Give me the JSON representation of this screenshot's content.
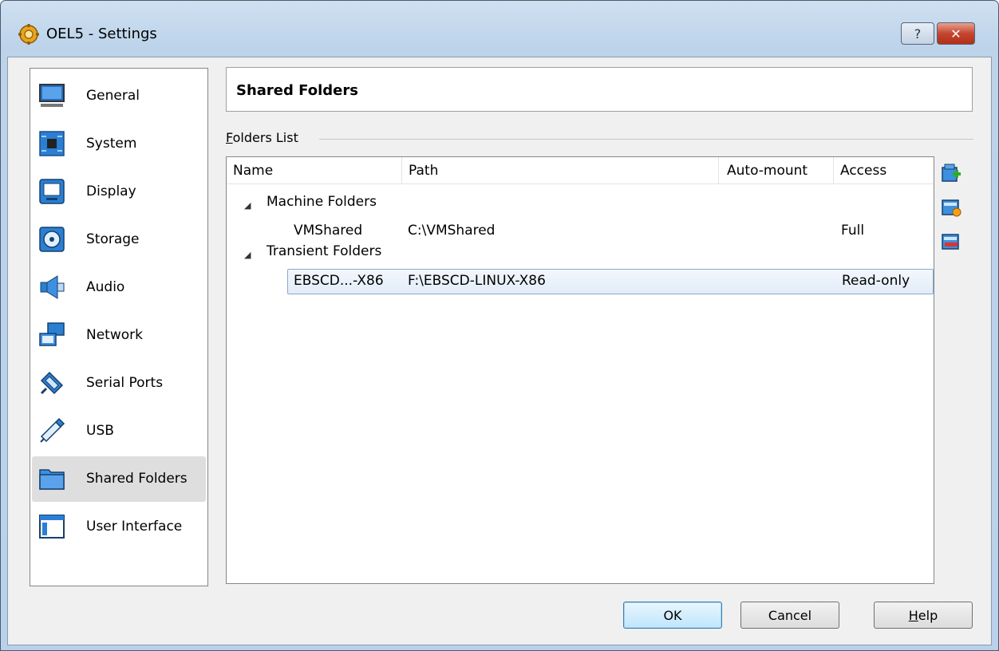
{
  "window": {
    "title": "OEL5 - Settings",
    "help_glyph": "?",
    "close_glyph": "✕"
  },
  "sidebar": {
    "items": [
      {
        "label": "General",
        "icon": "monitor-icon"
      },
      {
        "label": "System",
        "icon": "chip-icon"
      },
      {
        "label": "Display",
        "icon": "display-icon"
      },
      {
        "label": "Storage",
        "icon": "storage-icon"
      },
      {
        "label": "Audio",
        "icon": "speaker-icon"
      },
      {
        "label": "Network",
        "icon": "network-icon"
      },
      {
        "label": "Serial Ports",
        "icon": "serial-port-icon"
      },
      {
        "label": "USB",
        "icon": "usb-icon"
      },
      {
        "label": "Shared Folders",
        "icon": "folder-icon",
        "selected": true
      },
      {
        "label": "User Interface",
        "icon": "window-icon"
      }
    ]
  },
  "main": {
    "title": "Shared Folders",
    "group_label_mnemonic": "F",
    "group_label_rest": "olders List",
    "columns": [
      "Name",
      "Path",
      "Auto-mount",
      "Access"
    ],
    "groups": [
      {
        "expander": "◢",
        "name": "Machine Folders",
        "rows": [
          {
            "name": "VMShared",
            "path": "C:\\VMShared",
            "auto_mount": "",
            "access": "Full"
          }
        ]
      },
      {
        "expander": "◢",
        "name": "Transient Folders",
        "rows": [
          {
            "name": "EBSCD...-X86",
            "path": "F:\\EBSCD-LINUX-X86",
            "auto_mount": "",
            "access": "Read-only",
            "selected": true
          }
        ]
      }
    ]
  },
  "side_actions": [
    "add-folder-icon",
    "edit-folder-icon",
    "remove-folder-icon"
  ],
  "buttons": {
    "ok": "OK",
    "cancel": "Cancel",
    "help_mnemonic": "H",
    "help_rest": "elp"
  },
  "colors": {
    "title_gradient": "#cfe0f1",
    "selection": "#e2ecf8",
    "selection_border": "#8ba8cc",
    "nav_selected": "#dedede"
  }
}
